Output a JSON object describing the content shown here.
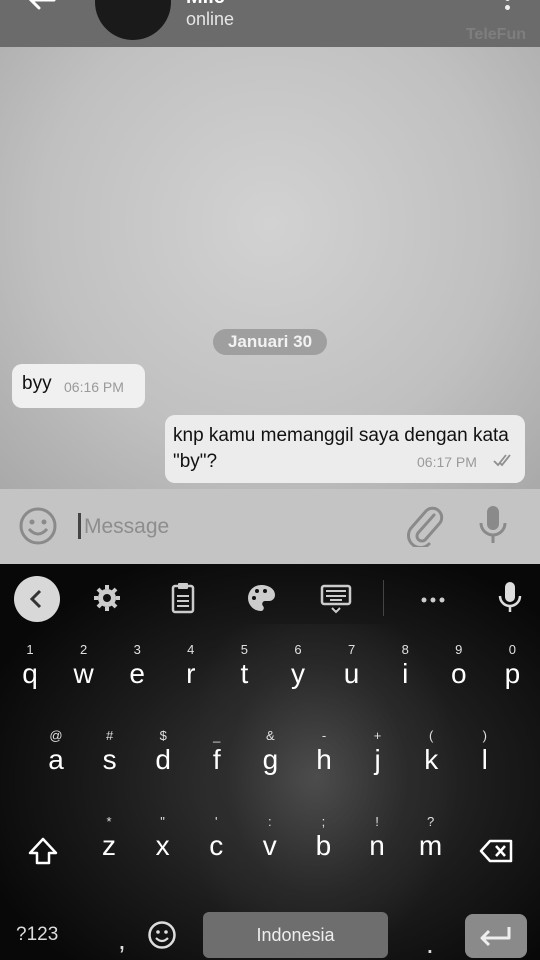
{
  "header": {
    "name": "Mile",
    "status": "online",
    "watermark": "TeleFun"
  },
  "chat": {
    "date_chip": "Januari 30",
    "messages": [
      {
        "direction": "in",
        "text": "byy",
        "time": "06:16 PM"
      },
      {
        "direction": "out",
        "text": "knp kamu memanggil saya dengan kata \"by\"?",
        "time": "06:17 PM",
        "status": "read"
      }
    ]
  },
  "input": {
    "placeholder": "Message"
  },
  "keyboard": {
    "toolbar": [
      "collapse-icon",
      "gear-icon",
      "clipboard-icon",
      "palette-icon",
      "keyboard-icon",
      "more-icon",
      "mic-icon"
    ],
    "row1": [
      {
        "key": "q",
        "hint": "1"
      },
      {
        "key": "w",
        "hint": "2"
      },
      {
        "key": "e",
        "hint": "3"
      },
      {
        "key": "r",
        "hint": "4"
      },
      {
        "key": "t",
        "hint": "5"
      },
      {
        "key": "y",
        "hint": "6"
      },
      {
        "key": "u",
        "hint": "7"
      },
      {
        "key": "i",
        "hint": "8"
      },
      {
        "key": "o",
        "hint": "9"
      },
      {
        "key": "p",
        "hint": "0"
      }
    ],
    "row2": [
      {
        "key": "a",
        "hint": "@"
      },
      {
        "key": "s",
        "hint": "#"
      },
      {
        "key": "d",
        "hint": "$"
      },
      {
        "key": "f",
        "hint": "_"
      },
      {
        "key": "g",
        "hint": "&"
      },
      {
        "key": "h",
        "hint": "-"
      },
      {
        "key": "j",
        "hint": "+"
      },
      {
        "key": "k",
        "hint": "("
      },
      {
        "key": "l",
        "hint": ")"
      }
    ],
    "row3": [
      {
        "key": "z",
        "hint": "*"
      },
      {
        "key": "x",
        "hint": "\""
      },
      {
        "key": "c",
        "hint": "'"
      },
      {
        "key": "v",
        "hint": ":"
      },
      {
        "key": "b",
        "hint": ";"
      },
      {
        "key": "n",
        "hint": "!"
      },
      {
        "key": "m",
        "hint": "?"
      }
    ],
    "symbols_label": "?123",
    "comma": ",",
    "space_label": "Indonesia",
    "period": "."
  }
}
